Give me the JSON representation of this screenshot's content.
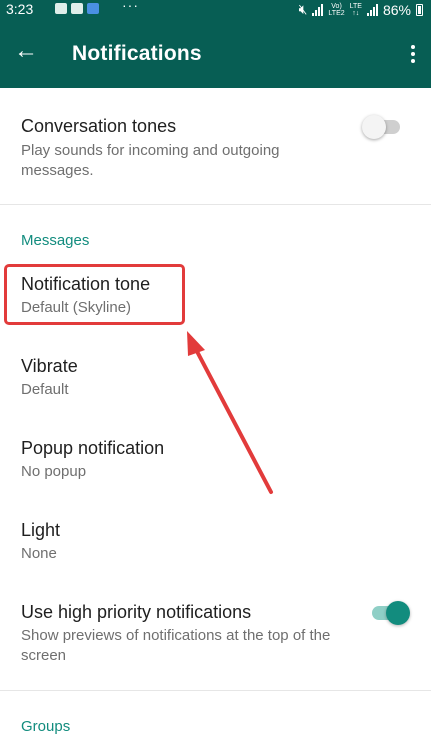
{
  "status_bar": {
    "time": "3:23",
    "dots": "···",
    "volte_label": "Vo)\nLTE2",
    "lte_label": "LTE\n↑↓",
    "battery_percent": "86%"
  },
  "app_bar": {
    "back_icon": "arrow-left-icon",
    "title": "Notifications",
    "menu_icon": "more-vertical-icon"
  },
  "conversation_tones": {
    "title": "Conversation tones",
    "subtitle": "Play sounds for incoming and outgoing messages.",
    "enabled": false
  },
  "messages_section": {
    "header": "Messages",
    "items": [
      {
        "title": "Notification tone",
        "value": "Default (Skyline)"
      },
      {
        "title": "Vibrate",
        "value": "Default"
      },
      {
        "title": "Popup notification",
        "value": "No popup"
      },
      {
        "title": "Light",
        "value": "None"
      }
    ],
    "high_priority": {
      "title": "Use high priority notifications",
      "subtitle": "Show previews of notifications at the top of the screen",
      "enabled": true
    }
  },
  "groups_section": {
    "header": "Groups"
  },
  "colors": {
    "app_bar": "#075e54",
    "accent": "#128c7e",
    "annotation": "#e23b3b"
  }
}
